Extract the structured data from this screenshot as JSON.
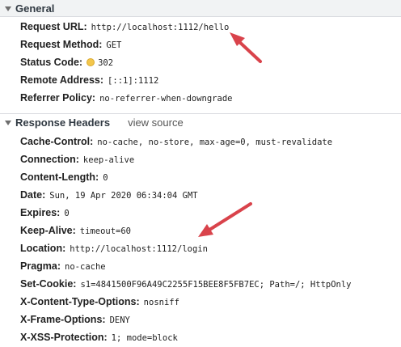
{
  "general": {
    "title": "General",
    "rows": [
      {
        "key": "Request URL:",
        "value": "http://localhost:1112/hello"
      },
      {
        "key": "Request Method:",
        "value": "GET"
      },
      {
        "key": "Status Code:",
        "value": "302",
        "status_color": "#f3c64b"
      },
      {
        "key": "Remote Address:",
        "value": "[::1]:1112"
      },
      {
        "key": "Referrer Policy:",
        "value": "no-referrer-when-downgrade"
      }
    ]
  },
  "response_headers": {
    "title": "Response Headers",
    "view_source": "view source",
    "rows": [
      {
        "key": "Cache-Control:",
        "value": "no-cache, no-store, max-age=0, must-revalidate"
      },
      {
        "key": "Connection:",
        "value": "keep-alive"
      },
      {
        "key": "Content-Length:",
        "value": "0"
      },
      {
        "key": "Date:",
        "value": "Sun, 19 Apr 2020 06:34:04 GMT"
      },
      {
        "key": "Expires:",
        "value": "0"
      },
      {
        "key": "Keep-Alive:",
        "value": "timeout=60"
      },
      {
        "key": "Location:",
        "value": "http://localhost:1112/login"
      },
      {
        "key": "Pragma:",
        "value": "no-cache"
      },
      {
        "key": "Set-Cookie:",
        "value": "s1=4841500F96A49C2255F15BEE8F5FB7EC; Path=/; HttpOnly"
      },
      {
        "key": "X-Content-Type-Options:",
        "value": "nosniff"
      },
      {
        "key": "X-Frame-Options:",
        "value": "DENY"
      },
      {
        "key": "X-XSS-Protection:",
        "value": "1; mode=block"
      }
    ]
  },
  "annotation_color": "#d9434b"
}
